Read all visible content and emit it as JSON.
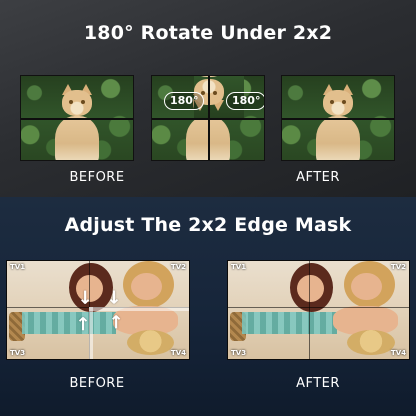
{
  "sections": {
    "rotate": {
      "title": "180° Rotate Under 2x2",
      "before_label": "BEFORE",
      "after_label": "AFTER",
      "rotation_badges": [
        "180°",
        "180°"
      ]
    },
    "edge_mask": {
      "title": "Adjust The 2x2 Edge Mask",
      "before_label": "BEFORE",
      "after_label": "AFTER",
      "tv_labels": [
        "TV1",
        "TV2",
        "TV3",
        "TV4"
      ]
    }
  },
  "colors": {
    "top_background": "#2f3135",
    "bottom_background": "#16253a",
    "text": "#ffffff"
  }
}
